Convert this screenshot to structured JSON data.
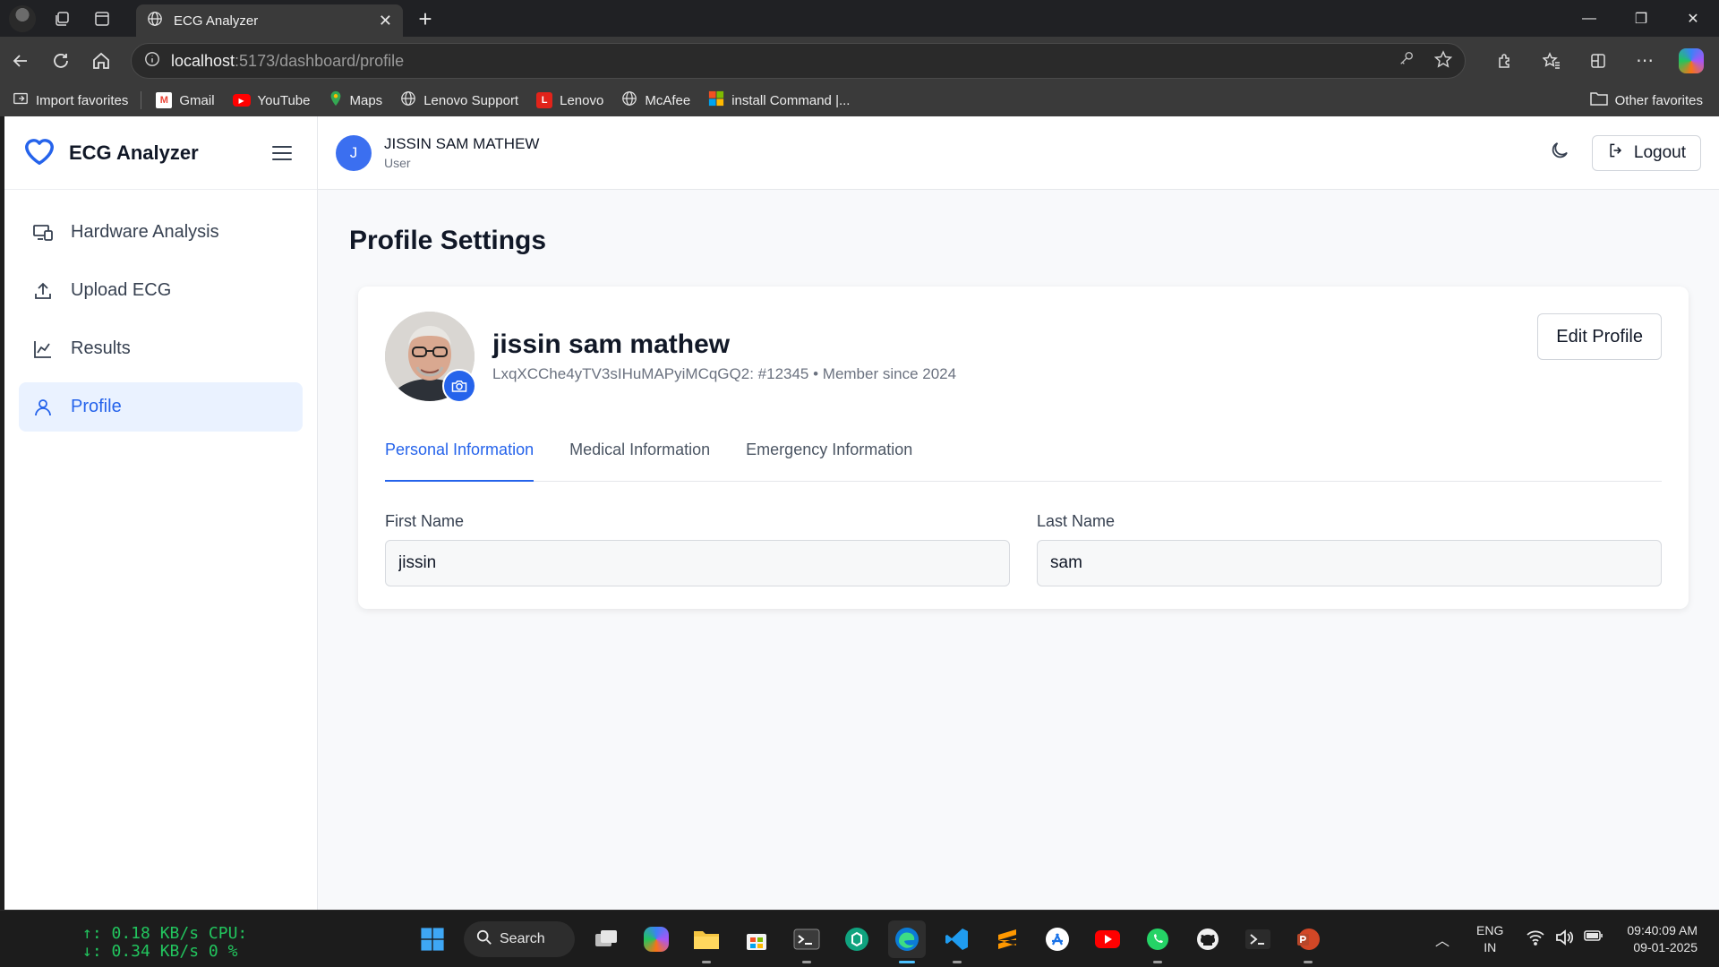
{
  "browser": {
    "tab_title": "ECG Analyzer",
    "url_host": "localhost",
    "url_path": ":5173/dashboard/profile",
    "bookmarks": [
      {
        "label": "Import favorites",
        "icon": "import-icon"
      },
      {
        "label": "Gmail",
        "icon": "gmail-icon"
      },
      {
        "label": "YouTube",
        "icon": "youtube-icon"
      },
      {
        "label": "Maps",
        "icon": "maps-icon"
      },
      {
        "label": "Lenovo Support",
        "icon": "globe-icon"
      },
      {
        "label": "Lenovo",
        "icon": "lenovo-icon"
      },
      {
        "label": "McAfee",
        "icon": "globe-icon"
      },
      {
        "label": "install Command |...",
        "icon": "microsoft-icon"
      }
    ],
    "other_favorites": "Other favorites"
  },
  "app": {
    "brand": "ECG Analyzer",
    "sidebar": {
      "items": [
        {
          "label": "Hardware Analysis",
          "icon": "devices-icon",
          "active": false
        },
        {
          "label": "Upload ECG",
          "icon": "upload-icon",
          "active": false
        },
        {
          "label": "Results",
          "icon": "chart-line-icon",
          "active": false
        },
        {
          "label": "Profile",
          "icon": "user-icon",
          "active": true
        }
      ]
    },
    "topbar": {
      "avatar_initial": "J",
      "user_name": "JISSIN SAM MATHEW",
      "user_role": "User",
      "logout_label": "Logout"
    },
    "page_title": "Profile Settings",
    "profile": {
      "name": "jissin sam mathew",
      "subtitle": "LxqXCChe4yTV3sIHuMAPyiMCqGQ2: #12345 • Member since 2024",
      "edit_label": "Edit Profile"
    },
    "tabs": [
      "Personal Information",
      "Medical Information",
      "Emergency Information"
    ],
    "form": {
      "first_name_label": "First Name",
      "first_name_value": "jissin",
      "last_name_label": "Last Name",
      "last_name_value": "sam"
    },
    "colors": {
      "accent": "#2563eb",
      "active_bg": "#eaf2ff"
    }
  },
  "taskbar": {
    "net_up": "↑:  0.18 KB/s",
    "net_down": "↓:  0.34 KB/s",
    "cpu_label": "CPU:",
    "cpu_value": "0 %",
    "search_label": "Search",
    "lang_top": "ENG",
    "lang_bottom": "IN",
    "time": "09:40:09 AM",
    "date": "09-01-2025"
  }
}
